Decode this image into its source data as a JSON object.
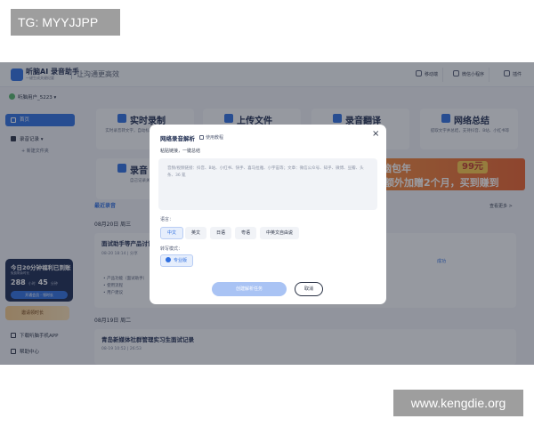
{
  "watermarks": {
    "top_left": "TG: MYYJJPP",
    "bottom_right": "www.kengdie.org"
  },
  "app": {
    "logo_name": "听脑AI 录音助手",
    "logo_sub": "一键生成关键纪要",
    "slogan": "让沟通更高效",
    "top_buttons": [
      "移动端",
      "微信小程序",
      "插件"
    ]
  },
  "sidebar": {
    "user": "听脑用户_5223",
    "nav_home": "首页",
    "nav_records": "录音记录",
    "nav_new_folder": "+ 新建文件夹",
    "promo": {
      "title": "今日20分钟福利已到账",
      "subtitle": "免费剩余时长",
      "hours": "288",
      "hours_unit": "小时",
      "minutes": "45",
      "minutes_unit": "分钟",
      "button": "开通会员 · 领时长"
    },
    "invite": "邀请领时长",
    "download_app": "下载听脑手机APP",
    "help": "帮助中心",
    "user_bottom": "听脑用户_5223"
  },
  "features": [
    {
      "title": "实时录制",
      "desc": "实时录音转文字，自动标注说话人 自动AI总结"
    },
    {
      "title": "上传文件",
      "desc": "上传音视频文件 转文字"
    },
    {
      "title": "录音翻译",
      "desc": "实时翻译"
    },
    {
      "title": "网络总结",
      "desc": "提取文字并总结，支持抖音、B站、小红书等"
    },
    {
      "title": "录音",
      "desc": "自己记录关键信息"
    }
  ],
  "banner": {
    "line1": "99元",
    "line2": "额外加赠2个月，买到赚到",
    "prefix": "听脑包年"
  },
  "recent": {
    "title": "最近录音",
    "more": "查看更多 >",
    "groups": [
      {
        "date": "08月20日 周三",
        "card_title": "面试助手等产品讨论",
        "meta": "08-20 18:14 | 分享",
        "status": "成功",
        "bullets": [
          "• 产品功能（面试助手）",
          "• 使用流程",
          "• 用户建议"
        ]
      },
      {
        "date": "08月19日 周二",
        "card_title": "青岛新媒体社群管理实习生面试记录",
        "meta": "08-19 10:52 | 26:53",
        "status": "",
        "bullets": []
      }
    ]
  },
  "modal": {
    "title": "网络录音解析",
    "help": "使用教程",
    "subtitle": "粘贴链接，一键总结",
    "input_placeholder": "音频/视频链接：抖音、B站、小红书、快手、喜马拉雅、小宇宙等；文章：微信公众号、知乎、微博、豆瓣、头条、36 氪",
    "language_label": "语言：",
    "languages": [
      "中文",
      "英文",
      "日语",
      "粤语",
      "中英文自由说"
    ],
    "selected_language": "中文",
    "mode_label": "转写模式：",
    "mode": "专业版",
    "create_button": "创建解析任务",
    "cancel_button": "取消"
  }
}
